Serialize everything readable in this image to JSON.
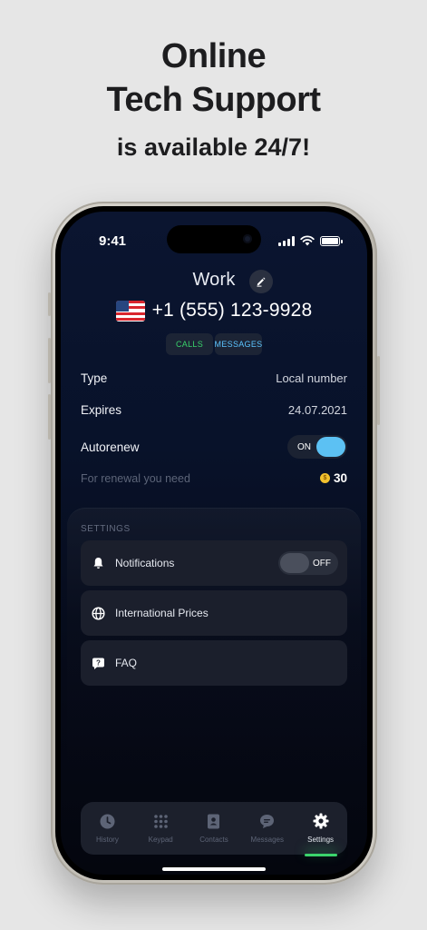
{
  "promo": {
    "line1": "Online",
    "line2": "Tech Support",
    "line3": "is available 24/7!"
  },
  "status_bar": {
    "time": "9:41"
  },
  "header": {
    "title": "Work",
    "phone_number": "+1 (555) 123-9928",
    "country_flag": "us-flag"
  },
  "chips": {
    "calls": "CALLS",
    "messages": "MESSAGES"
  },
  "details": {
    "type_label": "Type",
    "type_value": "Local number",
    "expires_label": "Expires",
    "expires_value": "24.07.2021",
    "autorenew_label": "Autorenew",
    "autorenew_state": "ON",
    "renewal_label": "For renewal you need",
    "renewal_cost": "30"
  },
  "settings": {
    "section_label": "SETTINGS",
    "items": [
      {
        "label": "Notifications",
        "icon": "bell-icon",
        "toggle": "OFF"
      },
      {
        "label": "International Prices",
        "icon": "globe-icon"
      },
      {
        "label": "FAQ",
        "icon": "question-bubble-icon"
      }
    ]
  },
  "tabbar": {
    "tabs": [
      {
        "label": "History",
        "icon": "clock-icon"
      },
      {
        "label": "Keypad",
        "icon": "keypad-icon"
      },
      {
        "label": "Contacts",
        "icon": "contacts-icon"
      },
      {
        "label": "Messages",
        "icon": "chat-icon"
      },
      {
        "label": "Settings",
        "icon": "gear-icon"
      }
    ],
    "active": "Settings"
  },
  "colors": {
    "accent_blue": "#5cc1f3",
    "accent_green": "#3bd46c",
    "coin": "#f2c12e"
  }
}
